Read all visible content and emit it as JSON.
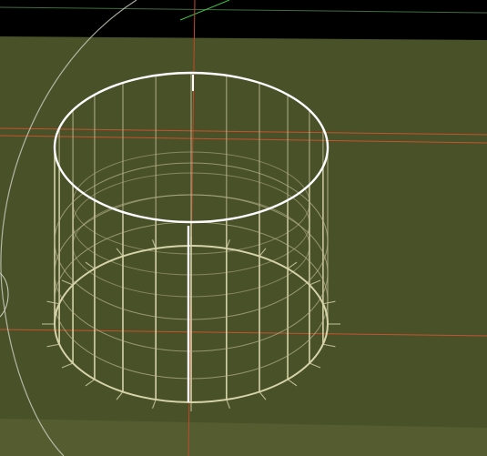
{
  "viewport": {
    "kind": "3d-viewport",
    "view": "perspective",
    "object": "cylinder",
    "display_mode": "wireframe",
    "selected_edges": [
      "top-rim",
      "front-seam"
    ],
    "colors": {
      "background_top": "#000000",
      "floor": "#495129",
      "floor_lower": "#545c30",
      "wire": "#d6d3a8",
      "wire_dim": "#b9b58d",
      "selected": "#ffffff",
      "axis_x": "#c8522c",
      "axis_y": "#3fbf3f",
      "grid_circle": "#cfd0c0"
    },
    "icons": [
      "cylinder-mesh-icon",
      "world-origin-icon"
    ]
  }
}
